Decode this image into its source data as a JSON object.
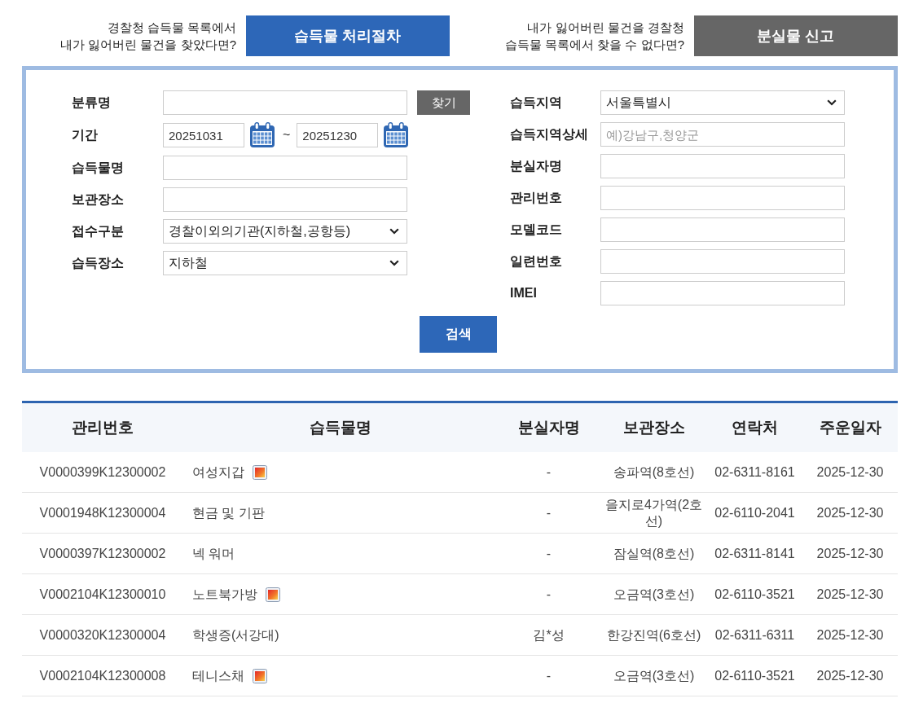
{
  "top_links": [
    {
      "text": "경찰청 습득물 목록에서\n내가 잃어버린 물건을 찾았다면?",
      "button": "습득물 처리절차",
      "kind": "primary"
    },
    {
      "text": "내가 잃어버린 물건을 경찰청\n습득물 목록에서 찾을 수 없다면?",
      "button": "분실물 신고",
      "kind": "secondary"
    }
  ],
  "search_form": {
    "left_fields": [
      {
        "label": "분류명",
        "kind": "text",
        "button": "찾기"
      },
      {
        "label": "기간",
        "kind": "date_range",
        "from": "20251031",
        "separator": "~",
        "to": "20251230"
      },
      {
        "label": "습득물명",
        "kind": "text"
      },
      {
        "label": "보관장소",
        "kind": "text"
      },
      {
        "label": "접수구분",
        "kind": "select",
        "value": "경찰이외의기관(지하철,공항등)"
      },
      {
        "label": "습득장소",
        "kind": "select",
        "value": "지하철"
      }
    ],
    "right_fields": [
      {
        "label": "습득지역",
        "kind": "select",
        "value": "서울특별시"
      },
      {
        "label": "습득지역상세",
        "kind": "text",
        "placeholder": "예)강남구,청양군"
      },
      {
        "label": "분실자명",
        "kind": "text"
      },
      {
        "label": "관리번호",
        "kind": "text"
      },
      {
        "label": "모델코드",
        "kind": "text"
      },
      {
        "label": "일련번호",
        "kind": "text"
      },
      {
        "label": "IMEI",
        "kind": "text"
      }
    ],
    "search_button": "검색"
  },
  "results_table": {
    "columns": [
      "관리번호",
      "습득물명",
      "분실자명",
      "보관장소",
      "연락처",
      "주운일자"
    ],
    "rows": [
      {
        "id": "V0000399K12300002",
        "item": "여성지갑",
        "photo": true,
        "owner": "-",
        "storage": "송파역(8호선)",
        "phone": "02-6311-8161",
        "date": "2025-12-30"
      },
      {
        "id": "V0001948K12300004",
        "item": "현금 및 기판",
        "photo": false,
        "owner": "-",
        "storage": "을지로4가역(2호선)",
        "phone": "02-6110-2041",
        "date": "2025-12-30"
      },
      {
        "id": "V0000397K12300002",
        "item": "넥 워머",
        "photo": false,
        "owner": "-",
        "storage": "잠실역(8호선)",
        "phone": "02-6311-8141",
        "date": "2025-12-30"
      },
      {
        "id": "V0002104K12300010",
        "item": "노트북가방",
        "photo": true,
        "owner": "-",
        "storage": "오금역(3호선)",
        "phone": "02-6110-3521",
        "date": "2025-12-30"
      },
      {
        "id": "V0000320K12300004",
        "item": "학생증(서강대)",
        "photo": false,
        "owner": "김*성",
        "storage": "한강진역(6호선)",
        "phone": "02-6311-6311",
        "date": "2025-12-30"
      },
      {
        "id": "V0002104K12300008",
        "item": "테니스채",
        "photo": true,
        "owner": "-",
        "storage": "오금역(3호선)",
        "phone": "02-6110-3521",
        "date": "2025-12-30"
      }
    ]
  }
}
